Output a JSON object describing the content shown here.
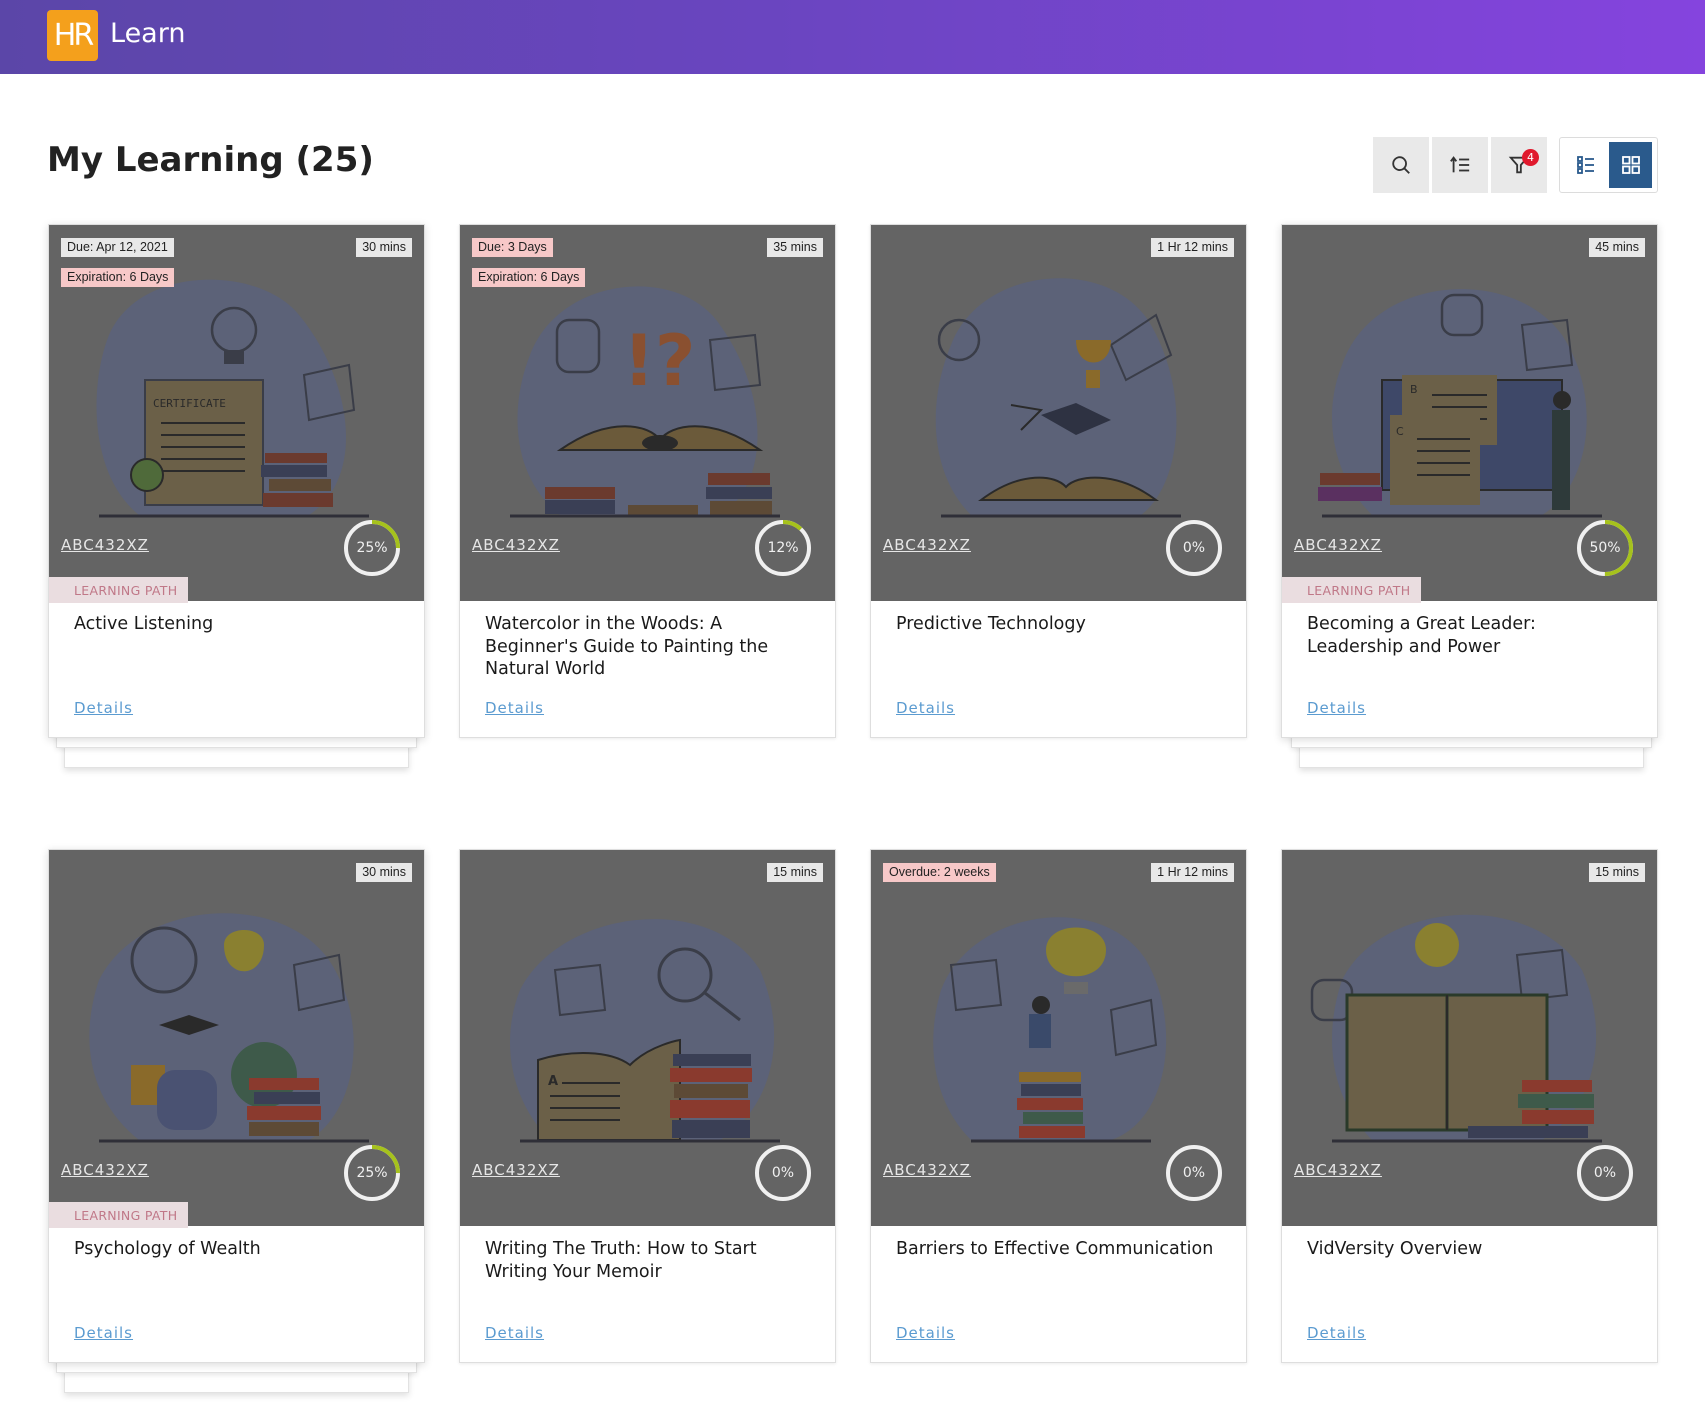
{
  "header": {
    "logo_text": "HR",
    "app_name": "Learn"
  },
  "page": {
    "title": "My Learning (25)"
  },
  "toolbar": {
    "search_icon": "search-icon",
    "sort_icon": "sort-icon",
    "filter_icon": "filter-icon",
    "filter_count": "4",
    "list_view_icon": "list-view-icon",
    "grid_view_icon": "grid-view-icon",
    "active_view": "grid"
  },
  "colors": {
    "header_start": "#5b46a8",
    "header_end": "#8544de",
    "logo": "#f4a01c",
    "progress": "#a6c21c",
    "details_link": "#5b9bd0",
    "badge": "#e0192d",
    "grid_toggle_active": "#2a5a8c"
  },
  "cards": [
    {
      "due": "Due: Apr 12, 2021",
      "expiration": "Expiration: 6 Days",
      "duration": "30 mins",
      "code": "ABC432XZ",
      "progress": 25,
      "progress_label": "25%",
      "type_label": "LEARNING PATH",
      "title": "Active Listening",
      "details": "Details"
    },
    {
      "due": "Due: 3 Days",
      "expiration": "Expiration: 6 Days",
      "duration": "35 mins",
      "code": "ABC432XZ",
      "progress": 12,
      "progress_label": "12%",
      "title": "Watercolor in the Woods: A Beginner's Guide to Painting the Natural World",
      "details": "Details"
    },
    {
      "duration": "1 Hr 12 mins",
      "code": "ABC432XZ",
      "progress": 0,
      "progress_label": "0%",
      "title": "Predictive Technology",
      "details": "Details"
    },
    {
      "duration": "45 mins",
      "code": "ABC432XZ",
      "progress": 50,
      "progress_label": "50%",
      "type_label": "LEARNING PATH",
      "title": "Becoming a Great Leader: Leadership and Power",
      "details": "Details"
    },
    {
      "duration": "30 mins",
      "code": "ABC432XZ",
      "progress": 25,
      "progress_label": "25%",
      "type_label": "LEARNING PATH",
      "title": "Psychology of Wealth",
      "details": "Details"
    },
    {
      "duration": "15 mins",
      "code": "ABC432XZ",
      "progress": 0,
      "progress_label": "0%",
      "title": "Writing The Truth: How to Start Writing Your Memoir",
      "details": "Details"
    },
    {
      "overdue": "Overdue: 2 weeks",
      "duration": "1 Hr 12 mins",
      "code": "ABC432XZ",
      "progress": 0,
      "progress_label": "0%",
      "title": "Barriers to Effective Communication",
      "details": "Details"
    },
    {
      "duration": "15 mins",
      "code": "ABC432XZ",
      "progress": 0,
      "progress_label": "0%",
      "title": "VidVersity Overview",
      "details": "Details"
    }
  ]
}
